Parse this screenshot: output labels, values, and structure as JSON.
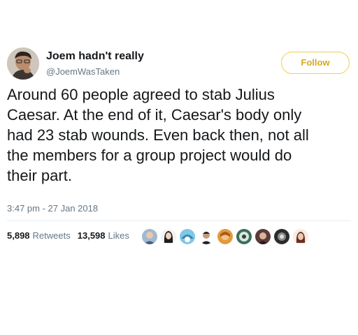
{
  "user": {
    "display_name": "Joem hadn't really",
    "handle": "@JoemWasTaken"
  },
  "follow_button": {
    "label": "Follow"
  },
  "tweet": {
    "text_lines": [
      "Around 60 people agreed to stab Julius",
      "Caesar. At the end of it, Caesar's body only",
      "had 23 stab wounds. Even back then, not all",
      "the members for a group project would do",
      "their part."
    ],
    "timestamp": "3:47 pm - 27 Jan 2018"
  },
  "stats": {
    "retweets_count": "5,898",
    "retweets_label": "Retweets",
    "likes_count": "13,598",
    "likes_label": "Likes"
  },
  "colors": {
    "accent": "#f0cf4f",
    "follow_text": "#d7a91a",
    "muted_text": "#657786",
    "primary_text": "#14171a"
  }
}
